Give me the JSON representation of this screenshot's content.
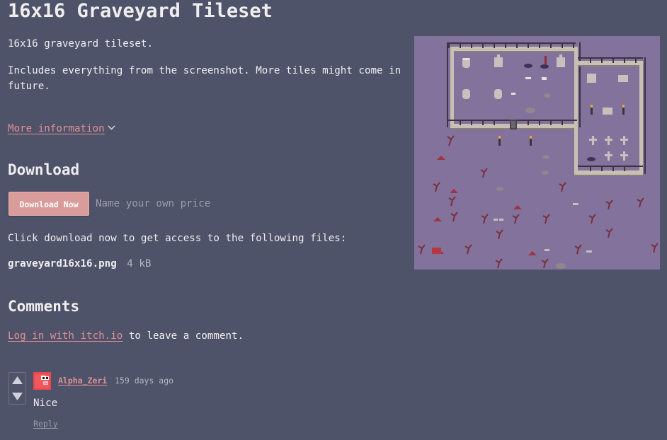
{
  "page": {
    "title": "16x16 Graveyard Tileset"
  },
  "description": {
    "line1": "16x16 graveyard tileset.",
    "line2": "Includes everything from the screenshot. More tiles might come in future."
  },
  "more_info": {
    "label": "More information",
    "icon": "chevron-down-icon"
  },
  "download": {
    "heading": "Download",
    "button_label": "Download Now",
    "price_placeholder": "Name your own price",
    "instructions": "Click download now to get access to the following files:",
    "files": [
      {
        "name": "graveyard16x16.png",
        "size": "4 kB"
      }
    ]
  },
  "comments": {
    "heading": "Comments",
    "login_link": "Log in with itch.io",
    "login_suffix": " to leave a comment.",
    "items": [
      {
        "author": "Alpha_Zeri",
        "date": "159 days ago",
        "body": "Nice",
        "reply_label": "Reply",
        "upvote_icon": "upvote-arrow-icon",
        "downvote_icon": "downvote-arrow-icon"
      }
    ]
  },
  "colors": {
    "background": "#4f536a",
    "text": "#eeeeee",
    "link": "#e08f94",
    "button": "#da9c9b",
    "muted": "#9a9cad",
    "screenshot_bg": "#83729c"
  }
}
